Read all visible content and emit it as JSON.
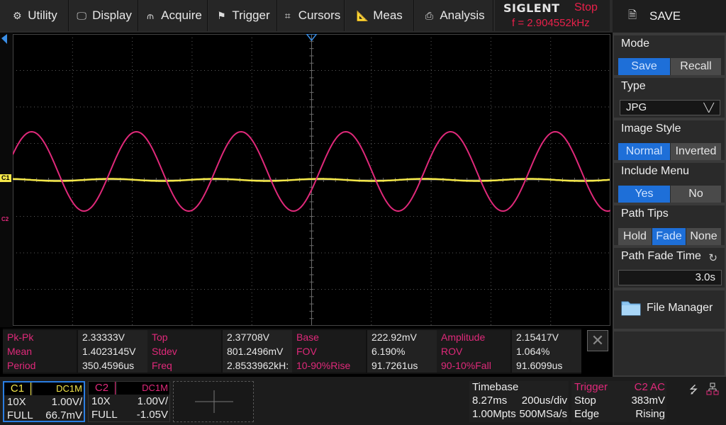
{
  "menu": {
    "utility": "Utility",
    "display": "Display",
    "acquire": "Acquire",
    "trigger": "Trigger",
    "cursors": "Cursors",
    "meas": "Meas",
    "analysis": "Analysis"
  },
  "brand": {
    "logo": "SIGLENT",
    "state": "Stop",
    "frequency": "f = 2.904552kHz"
  },
  "panel": {
    "title": "SAVE",
    "mode": {
      "label": "Mode",
      "options": [
        "Save",
        "Recall"
      ],
      "selected": "Save"
    },
    "type": {
      "label": "Type",
      "value": "JPG"
    },
    "image_style": {
      "label": "Image Style",
      "options": [
        "Normal",
        "Inverted"
      ],
      "selected": "Normal"
    },
    "include_menu": {
      "label": "Include Menu",
      "options": [
        "Yes",
        "No"
      ],
      "selected": "Yes"
    },
    "path_tips": {
      "label": "Path Tips",
      "options": [
        "Hold",
        "Fade",
        "None"
      ],
      "selected": "Fade"
    },
    "path_fade_time": {
      "label": "Path Fade Time",
      "value": "3.0s"
    },
    "file_manager": "File Manager"
  },
  "channel_markers": {
    "c1": "C1",
    "c2": "C2"
  },
  "measurements": [
    [
      {
        "name": "Pk-Pk",
        "value": "2.33333V"
      },
      {
        "name": "Top",
        "value": "2.37708V"
      },
      {
        "name": "Base",
        "value": "222.92mV"
      },
      {
        "name": "Amplitude",
        "value": "2.15417V"
      }
    ],
    [
      {
        "name": "Mean",
        "value": "1.4023145V"
      },
      {
        "name": "Stdev",
        "value": "801.2496mV"
      },
      {
        "name": "FOV",
        "value": "6.190%"
      },
      {
        "name": "ROV",
        "value": "1.064%"
      }
    ],
    [
      {
        "name": "Period",
        "value": "350.4596us"
      },
      {
        "name": "Freq",
        "value": "2.8533962kH:"
      },
      {
        "name": "10-90%Rise",
        "value": "91.7261us"
      },
      {
        "name": "90-10%Fall",
        "value": "91.6099us"
      }
    ]
  ],
  "channels": [
    {
      "name": "C1",
      "coupling": "DC1M",
      "probe": "10X",
      "scale": "1.00V/",
      "bw": "FULL",
      "offset": "66.7mV",
      "color": "#f5e84a"
    },
    {
      "name": "C2",
      "coupling": "DC1M",
      "probe": "10X",
      "scale": "1.00V/",
      "bw": "FULL",
      "offset": "-1.05V",
      "color": "#e0297a"
    }
  ],
  "timebase": {
    "label": "Timebase",
    "delay": "8.27ms",
    "scale": "200us/div",
    "memory": "1.00Mpts",
    "sample_rate": "500MSa/s"
  },
  "trigger": {
    "label": "Trigger",
    "source": "C2 AC",
    "state": "Stop",
    "level": "383mV",
    "type": "Edge",
    "slope": "Rising"
  },
  "colors": {
    "c1": "#f5e84a",
    "c2": "#e0297a",
    "accent": "#1e6fd8",
    "grid": "#5a5a5a"
  }
}
